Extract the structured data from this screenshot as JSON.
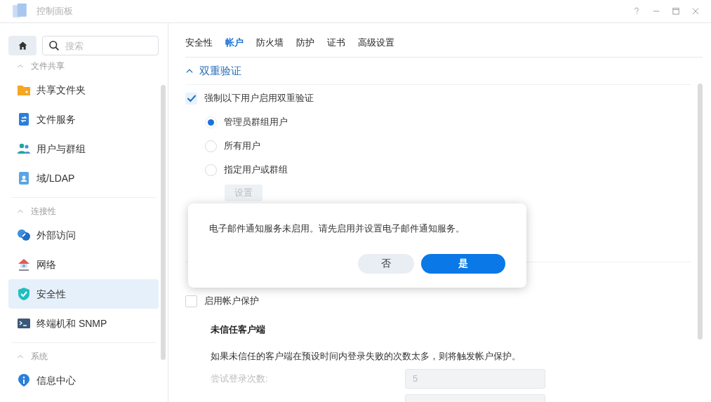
{
  "window": {
    "title": "控制面板"
  },
  "sidebar": {
    "search": {
      "placeholder": "搜索"
    },
    "groups": [
      {
        "label": "文件共享",
        "expanded": true,
        "items": [
          {
            "label": "共享文件夹",
            "selected": false
          },
          {
            "label": "文件服务",
            "selected": false
          },
          {
            "label": "用户与群组",
            "selected": false
          },
          {
            "label": "域/LDAP",
            "selected": false
          }
        ]
      },
      {
        "label": "连接性",
        "expanded": true,
        "items": [
          {
            "label": "外部访问",
            "selected": false
          },
          {
            "label": "网络",
            "selected": false
          },
          {
            "label": "安全性",
            "selected": true
          },
          {
            "label": "终端机和 SNMP",
            "selected": false
          }
        ]
      },
      {
        "label": "系统",
        "expanded": true,
        "items": [
          {
            "label": "信息中心",
            "selected": false
          }
        ]
      }
    ]
  },
  "tabs": [
    {
      "label": "安全性",
      "selected": false
    },
    {
      "label": "帐户",
      "selected": true
    },
    {
      "label": "防火墙",
      "selected": false
    },
    {
      "label": "防护",
      "selected": false
    },
    {
      "label": "证书",
      "selected": false
    },
    {
      "label": "高级设置",
      "selected": false
    }
  ],
  "section": {
    "title": "双重验证",
    "expanded": true
  },
  "enforce": {
    "label": "强制以下用户启用双重验证",
    "checked": true
  },
  "options": [
    {
      "label": "管理员群组用户",
      "selected": true
    },
    {
      "label": "所有用户",
      "selected": false
    },
    {
      "label": "指定用户或群组",
      "selected": false
    }
  ],
  "settings_button": {
    "label": "设置",
    "disabled": true
  },
  "protection": {
    "label": "启用帐户保护",
    "checked": false
  },
  "untrusted": {
    "heading": "未信任客户端",
    "description": "如果未信任的客户端在预设时间内登录失败的次数太多，则将触发帐户保护。",
    "fields": [
      {
        "label": "尝试登录次数:",
        "value": "5",
        "disabled": true
      },
      {
        "disabled": true
      }
    ]
  },
  "dialog": {
    "message": "电子邮件通知服务未启用。请先启用并设置电子邮件通知服务。",
    "buttons": [
      {
        "label": "否",
        "kind": "secondary"
      },
      {
        "label": "是",
        "kind": "primary"
      }
    ]
  }
}
